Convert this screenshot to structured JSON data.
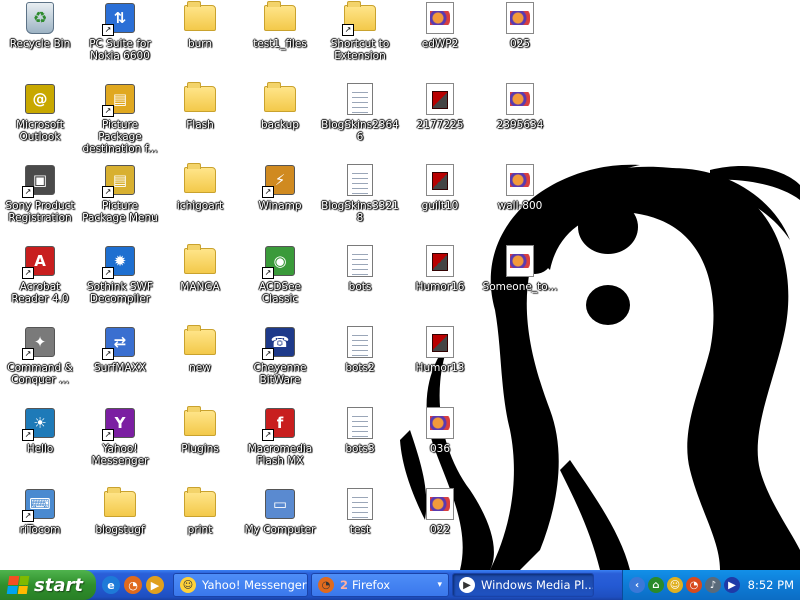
{
  "desktop": {
    "icons": [
      {
        "label": "Recycle Bin",
        "icon": "recycle-bin-icon",
        "kind": "recycle",
        "shortcut": false
      },
      {
        "label": "PC Suite for Nokia 6600",
        "icon": "nokia-pc-suite-icon",
        "kind": "generic",
        "color": "#2b6fd6",
        "glyph": "⇅",
        "shortcut": true
      },
      {
        "label": "burn",
        "icon": "folder-icon",
        "kind": "folder",
        "shortcut": false
      },
      {
        "label": "test1_files",
        "icon": "folder-icon",
        "kind": "folder",
        "shortcut": false
      },
      {
        "label": "Shortcut to Extension",
        "icon": "folder-icon",
        "kind": "folder",
        "shortcut": true
      },
      {
        "label": "edWP2",
        "icon": "image-file-icon",
        "kind": "image",
        "shortcut": false
      },
      {
        "label": "025",
        "icon": "image-file-icon",
        "kind": "image",
        "shortcut": false
      },
      {
        "label": "Microsoft Outlook",
        "icon": "outlook-icon",
        "kind": "generic",
        "color": "#c8a800",
        "glyph": "@",
        "shortcut": false
      },
      {
        "label": "Picture Package destination f...",
        "icon": "picture-package-icon",
        "kind": "generic",
        "color": "#e0a820",
        "glyph": "▤",
        "shortcut": true
      },
      {
        "label": "Flash",
        "icon": "folder-icon",
        "kind": "folder",
        "shortcut": false
      },
      {
        "label": "backup",
        "icon": "zip-folder-icon",
        "kind": "folder",
        "shortcut": false
      },
      {
        "label": "BlogSkins23646",
        "icon": "text-document-icon",
        "kind": "doc",
        "shortcut": false
      },
      {
        "label": "2177225",
        "icon": "video-file-icon",
        "kind": "video",
        "shortcut": false
      },
      {
        "label": "2395634",
        "icon": "image-file-icon",
        "kind": "image",
        "shortcut": false
      },
      {
        "label": "Sony Product Registration",
        "icon": "sony-registration-icon",
        "kind": "generic",
        "color": "#4a4a4a",
        "glyph": "▣",
        "shortcut": true
      },
      {
        "label": "Picture Package Menu",
        "icon": "picture-package-icon",
        "kind": "generic",
        "color": "#d8b030",
        "glyph": "▤",
        "shortcut": true
      },
      {
        "label": "ichigoart",
        "icon": "folder-icon",
        "kind": "folder",
        "shortcut": false
      },
      {
        "label": "Winamp",
        "icon": "winamp-icon",
        "kind": "generic",
        "color": "#d08a20",
        "glyph": "⚡",
        "shortcut": true
      },
      {
        "label": "BlogSkins33218",
        "icon": "text-document-icon",
        "kind": "doc",
        "shortcut": false
      },
      {
        "label": "guilt10",
        "icon": "video-file-icon",
        "kind": "video",
        "shortcut": false
      },
      {
        "label": "wall-800",
        "icon": "image-file-icon",
        "kind": "image",
        "shortcut": false
      },
      {
        "label": "Acrobat Reader 4.0",
        "icon": "acrobat-reader-icon",
        "kind": "generic",
        "color": "#c81e1e",
        "glyph": "A",
        "shortcut": true
      },
      {
        "label": "Sothink SWF Decompiler",
        "icon": "sothink-swf-icon",
        "kind": "generic",
        "color": "#1e6fd0",
        "glyph": "✹",
        "shortcut": true
      },
      {
        "label": "MANGA",
        "icon": "folder-icon",
        "kind": "folder",
        "shortcut": false
      },
      {
        "label": "ACDSee Classic",
        "icon": "acdsee-icon",
        "kind": "generic",
        "color": "#3a9a3a",
        "glyph": "◉",
        "shortcut": true
      },
      {
        "label": "bots",
        "icon": "text-document-icon",
        "kind": "doc",
        "shortcut": false
      },
      {
        "label": "Humor16",
        "icon": "video-file-icon",
        "kind": "video",
        "shortcut": false
      },
      {
        "label": "Someone_to...",
        "icon": "image-file-icon",
        "kind": "image",
        "shortcut": false
      },
      {
        "label": "Command & Conquer ...",
        "icon": "command-conquer-icon",
        "kind": "generic",
        "color": "#7a7a7a",
        "glyph": "✦",
        "shortcut": true
      },
      {
        "label": "SurfMAXX",
        "icon": "surfmaxx-icon",
        "kind": "generic",
        "color": "#3a6fd0",
        "glyph": "⇄",
        "shortcut": true
      },
      {
        "label": "new",
        "icon": "folder-icon",
        "kind": "folder",
        "shortcut": false
      },
      {
        "label": "Cheyenne BitWare",
        "icon": "cheyenne-bitware-icon",
        "kind": "generic",
        "color": "#1e3a8a",
        "glyph": "☎",
        "shortcut": true
      },
      {
        "label": "bots2",
        "icon": "text-document-icon",
        "kind": "doc",
        "shortcut": false
      },
      {
        "label": "Humor13",
        "icon": "video-file-icon",
        "kind": "video",
        "shortcut": false
      },
      {
        "label": "Hello",
        "icon": "hello-icon",
        "kind": "generic",
        "color": "#1e7ab8",
        "glyph": "☀",
        "shortcut": true
      },
      {
        "label": "Yahoo! Messenger",
        "icon": "yahoo-messenger-icon",
        "kind": "generic",
        "color": "#7b1fa2",
        "glyph": "Y",
        "shortcut": true
      },
      {
        "label": "Plugins",
        "icon": "folder-icon",
        "kind": "folder",
        "shortcut": false
      },
      {
        "label": "Macromedia Flash MX",
        "icon": "macromedia-flash-icon",
        "kind": "generic",
        "color": "#c81e1e",
        "glyph": "f",
        "shortcut": true
      },
      {
        "label": "bots3",
        "icon": "text-document-icon",
        "kind": "doc",
        "shortcut": false
      },
      {
        "label": "036",
        "icon": "image-file-icon",
        "kind": "image",
        "shortcut": false
      },
      {
        "label": "riTocom",
        "icon": "network-computer-icon",
        "kind": "generic",
        "color": "#4a8ad0",
        "glyph": "⌨",
        "shortcut": true
      },
      {
        "label": "blogstugf",
        "icon": "folder-icon",
        "kind": "folder",
        "shortcut": false
      },
      {
        "label": "print",
        "icon": "folder-icon",
        "kind": "folder",
        "shortcut": false
      },
      {
        "label": "My Computer",
        "icon": "my-computer-icon",
        "kind": "generic",
        "color": "#5a8ad0",
        "glyph": "▭",
        "shortcut": false
      },
      {
        "label": "test",
        "icon": "text-document-icon",
        "kind": "doc",
        "shortcut": false
      },
      {
        "label": "022",
        "icon": "image-file-icon",
        "kind": "image",
        "shortcut": false
      }
    ]
  },
  "taskbar": {
    "start_label": "start",
    "quick_launch": [
      {
        "icon": "internet-explorer-icon",
        "color": "#1e7ad8",
        "glyph": "e"
      },
      {
        "icon": "firefox-icon",
        "color": "#e06a1e",
        "glyph": "◔"
      },
      {
        "icon": "media-player-icon",
        "color": "#e0a01e",
        "glyph": "▶"
      }
    ],
    "tasks": [
      {
        "label": "Yahoo! Messenger",
        "icon": "yahoo-messenger-icon",
        "color": "#ffd23a",
        "glyph": "☺",
        "count": "",
        "group": false,
        "active": false
      },
      {
        "label": "Firefox",
        "icon": "firefox-icon",
        "color": "#e06a1e",
        "glyph": "◔",
        "count": "2",
        "group": true,
        "active": false
      },
      {
        "label": "Windows Media Pl...",
        "icon": "media-player-icon",
        "color": "#ffffff",
        "glyph": "▶",
        "count": "",
        "group": false,
        "active": true
      }
    ],
    "tray": {
      "icons": [
        {
          "icon": "tray-expand-icon",
          "color": "#3a78d8",
          "glyph": "‹"
        },
        {
          "icon": "tray-network-icon",
          "color": "#2a8a2a",
          "glyph": "⌂"
        },
        {
          "icon": "tray-yahoo-icon",
          "color": "#e0b020",
          "glyph": "☺"
        },
        {
          "icon": "tray-firefox-icon",
          "color": "#d84a1e",
          "glyph": "◔"
        },
        {
          "icon": "tray-volume-icon",
          "color": "#5a6a7a",
          "glyph": "♪"
        },
        {
          "icon": "tray-media-icon",
          "color": "#1e3aa8",
          "glyph": "▶"
        }
      ],
      "clock": "8:52 PM"
    }
  }
}
